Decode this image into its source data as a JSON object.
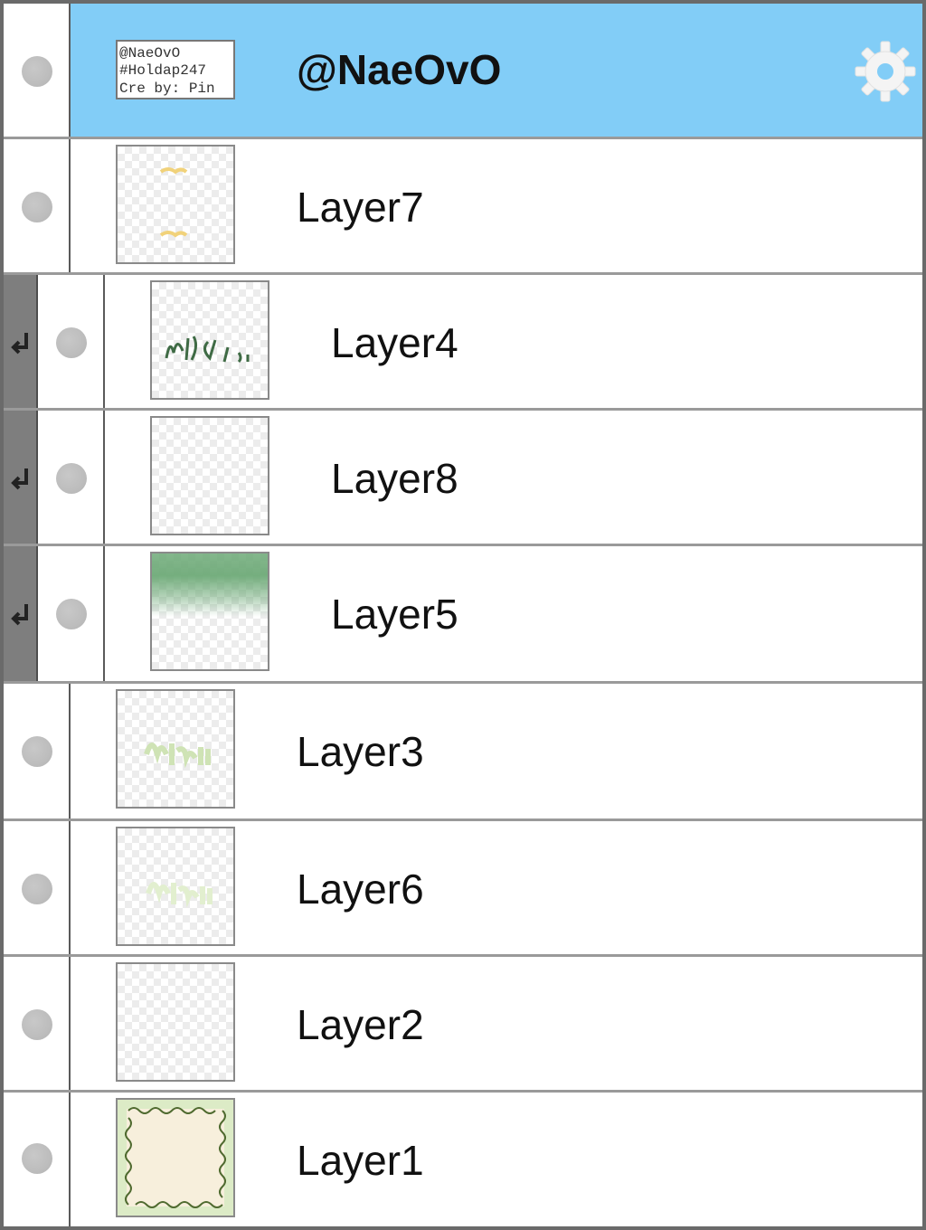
{
  "layers_panel": {
    "header_layer": {
      "name": "@NaeOvO",
      "thumbnail_lines": [
        "@NaeOvO",
        "#Holdap247",
        "Cre by: Pin"
      ],
      "selected": true,
      "settings_icon": "gear-icon"
    },
    "layers": [
      {
        "name": "Layer7",
        "clipped": false,
        "thumbnail": "two small yellow marks"
      },
      {
        "name": "Layer4",
        "clipped": true,
        "thumbnail": "dark green handwritten strokes"
      },
      {
        "name": "Layer8",
        "clipped": true,
        "thumbnail": "empty"
      },
      {
        "name": "Layer5",
        "clipped": true,
        "thumbnail": "green horizontal band"
      },
      {
        "name": "Layer3",
        "clipped": false,
        "thumbnail": "light green handwriting"
      },
      {
        "name": "Layer6",
        "clipped": false,
        "thumbnail": "pale green handwriting"
      },
      {
        "name": "Layer2",
        "clipped": false,
        "thumbnail": "empty"
      },
      {
        "name": "Layer1",
        "clipped": false,
        "thumbnail": "cream stamp frame on green"
      }
    ],
    "icons": {
      "visibility": "visibility-dot-icon",
      "clipping": "clipping-arrow-icon",
      "settings": "gear-icon"
    },
    "colors": {
      "selected_row": "#82cdf7",
      "clip_bar": "#7e7e7e",
      "row_border": "#9a9a9a",
      "visibility_dot": "#c0c0c0"
    }
  }
}
